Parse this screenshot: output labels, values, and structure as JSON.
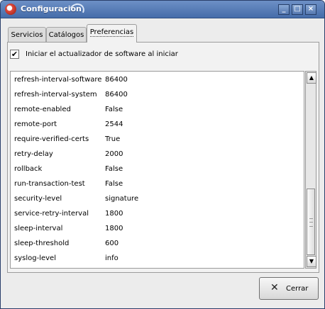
{
  "window": {
    "title": "Configuración",
    "minimize_symbol": "_",
    "maximize_symbol": "□",
    "close_symbol": "×"
  },
  "tabs": [
    {
      "label": "Servicios"
    },
    {
      "label": "Catálogos"
    },
    {
      "label": "Preferencias"
    }
  ],
  "preferences": {
    "auto_update_label": "Iniciar el actualizador de software al iniciar",
    "auto_update_checked": true,
    "checkmark": "✔",
    "settings": [
      {
        "key": "refresh-interval-software",
        "value": "86400"
      },
      {
        "key": "refresh-interval-system",
        "value": "86400"
      },
      {
        "key": "remote-enabled",
        "value": "False"
      },
      {
        "key": "remote-port",
        "value": "2544"
      },
      {
        "key": "require-verified-certs",
        "value": "True"
      },
      {
        "key": "retry-delay",
        "value": "2000"
      },
      {
        "key": "rollback",
        "value": "False"
      },
      {
        "key": "run-transaction-test",
        "value": "False"
      },
      {
        "key": "security-level",
        "value": "signature"
      },
      {
        "key": "service-retry-interval",
        "value": "1800"
      },
      {
        "key": "sleep-interval",
        "value": "1800"
      },
      {
        "key": "sleep-threshold",
        "value": "600"
      },
      {
        "key": "syslog-level",
        "value": "info"
      }
    ]
  },
  "scrollbar": {
    "up_arrow": "▲",
    "down_arrow": "▼"
  },
  "footer": {
    "close_label": "Cerrar",
    "close_icon_glyph": "✕"
  },
  "icons": {
    "app": "app-icon",
    "close": "close-icon"
  }
}
